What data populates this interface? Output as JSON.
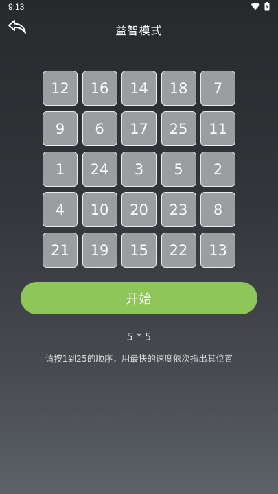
{
  "status_bar": {
    "time": "9:13"
  },
  "header": {
    "title": "益智模式",
    "back_icon": "back-arrow-icon"
  },
  "grid": {
    "rows": 5,
    "cols": 5,
    "tiles": [
      "12",
      "16",
      "14",
      "18",
      "7",
      "9",
      "6",
      "17",
      "25",
      "11",
      "1",
      "24",
      "3",
      "5",
      "2",
      "4",
      "10",
      "20",
      "23",
      "8",
      "21",
      "19",
      "15",
      "22",
      "13"
    ]
  },
  "start_button": {
    "label": "开始"
  },
  "info": {
    "size": "5 * 5",
    "instructions": "请按1到25的顺序，用最快的速度依次指出其位置"
  },
  "colors": {
    "accent": "#8ec65a",
    "tile_bg": "#9b9ea1",
    "tile_border": "#e9eaeb"
  }
}
